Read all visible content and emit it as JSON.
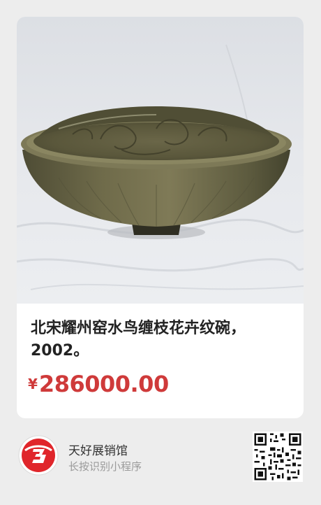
{
  "product": {
    "title": "北宋耀州窑水鸟缠枝花卉纹碗，2002。",
    "currency_symbol": "¥",
    "price": "286000.00"
  },
  "footer": {
    "brand_name": "天好展销馆",
    "hint": "长按识别小程序"
  },
  "colors": {
    "price": "#cf3a3a",
    "background": "#ededed",
    "card": "#ffffff",
    "logo_red": "#e0262b"
  },
  "icons": {
    "logo": "brand-logo-icon",
    "qr": "qr-code-icon"
  }
}
